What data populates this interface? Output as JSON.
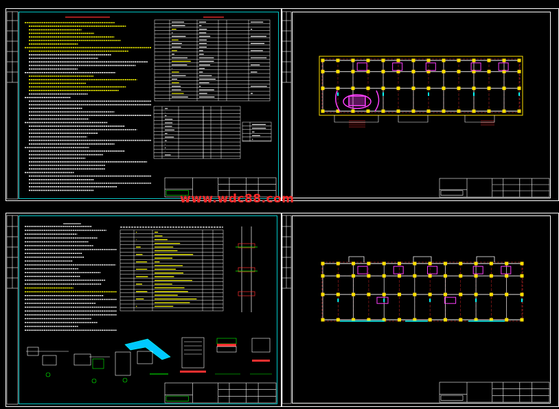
{
  "watermark": "www.wdc88.com",
  "colors": {
    "background": "#000000",
    "sheet_border": "#ffffff",
    "left_frame": "#00c8c8",
    "text_yellow": "#ffff00",
    "text_white": "#ffffff",
    "column_yellow": "#ffe000",
    "axis_red": "#ff3030",
    "wall_magenta": "#ff40ff",
    "annotation_cyan": "#00ffff",
    "watermark_red": "#ff2a2a"
  }
}
